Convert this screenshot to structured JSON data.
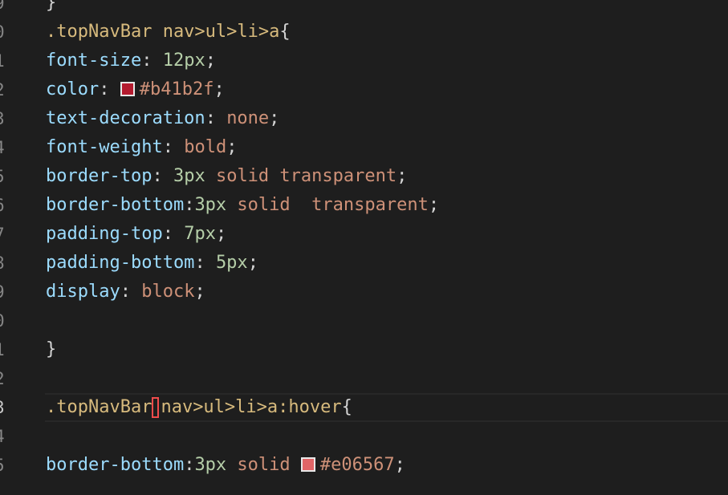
{
  "editor": {
    "lines": [
      {
        "num": "9",
        "tokens": [
          [
            "punc",
            "}"
          ]
        ]
      },
      {
        "num": "0",
        "tokens": [
          [
            "sel",
            ".topNavBar nav>ul>li>a"
          ],
          [
            "punc",
            "{"
          ]
        ]
      },
      {
        "num": "1",
        "tokens": [
          [
            "prop",
            "font-size"
          ],
          [
            "punc",
            ": "
          ],
          [
            "num",
            "12px"
          ],
          [
            "punc",
            ";"
          ]
        ]
      },
      {
        "num": "2",
        "tokens": [
          [
            "prop",
            "color"
          ],
          [
            "punc",
            ": "
          ],
          [
            "swatch",
            "#b41b2f"
          ],
          [
            "val",
            "#b41b2f"
          ],
          [
            "punc",
            ";"
          ]
        ]
      },
      {
        "num": "3",
        "tokens": [
          [
            "prop",
            "text-decoration"
          ],
          [
            "punc",
            ": "
          ],
          [
            "val",
            "none"
          ],
          [
            "punc",
            ";"
          ]
        ]
      },
      {
        "num": "4",
        "tokens": [
          [
            "prop",
            "font-weight"
          ],
          [
            "punc",
            ": "
          ],
          [
            "val",
            "bold"
          ],
          [
            "punc",
            ";"
          ]
        ]
      },
      {
        "num": "5",
        "tokens": [
          [
            "prop",
            "border-top"
          ],
          [
            "punc",
            ": "
          ],
          [
            "num",
            "3px"
          ],
          [
            "val",
            " solid transparent"
          ],
          [
            "punc",
            ";"
          ]
        ]
      },
      {
        "num": "6",
        "tokens": [
          [
            "prop",
            "border-bottom"
          ],
          [
            "punc",
            ":"
          ],
          [
            "num",
            "3px"
          ],
          [
            "val",
            " solid  transparent"
          ],
          [
            "punc",
            ";"
          ]
        ]
      },
      {
        "num": "7",
        "tokens": [
          [
            "prop",
            "padding-top"
          ],
          [
            "punc",
            ": "
          ],
          [
            "num",
            "7px"
          ],
          [
            "punc",
            ";"
          ]
        ]
      },
      {
        "num": "8",
        "tokens": [
          [
            "prop",
            "padding-bottom"
          ],
          [
            "punc",
            ": "
          ],
          [
            "num",
            "5px"
          ],
          [
            "punc",
            ";"
          ]
        ]
      },
      {
        "num": "9",
        "tokens": [
          [
            "prop",
            "display"
          ],
          [
            "punc",
            ": "
          ],
          [
            "val",
            "block"
          ],
          [
            "punc",
            ";"
          ]
        ]
      },
      {
        "num": "0",
        "tokens": []
      },
      {
        "num": "1",
        "tokens": [
          [
            "punc",
            "}"
          ]
        ]
      },
      {
        "num": "2",
        "tokens": []
      },
      {
        "num": "3",
        "current": true,
        "tokens": [
          [
            "sel",
            ".topNavBar"
          ],
          [
            "cursor",
            ""
          ],
          [
            "sel",
            "nav>ul>li>a:hover"
          ],
          [
            "punc",
            "{"
          ]
        ]
      },
      {
        "num": "4",
        "tokens": []
      },
      {
        "num": "5",
        "tokens": [
          [
            "prop",
            "border-bottom"
          ],
          [
            "punc",
            ":"
          ],
          [
            "num",
            "3px"
          ],
          [
            "val",
            " solid "
          ],
          [
            "swatch",
            "#e06567"
          ],
          [
            "val",
            "#e06567"
          ],
          [
            "punc",
            ";"
          ]
        ]
      }
    ]
  },
  "colors": {
    "background": "#1e1e1e",
    "selector": "#d7ba7d",
    "property": "#9cdcfe",
    "number": "#b5cea8",
    "value": "#ce9178",
    "cursor_highlight": "#f14c4c"
  }
}
